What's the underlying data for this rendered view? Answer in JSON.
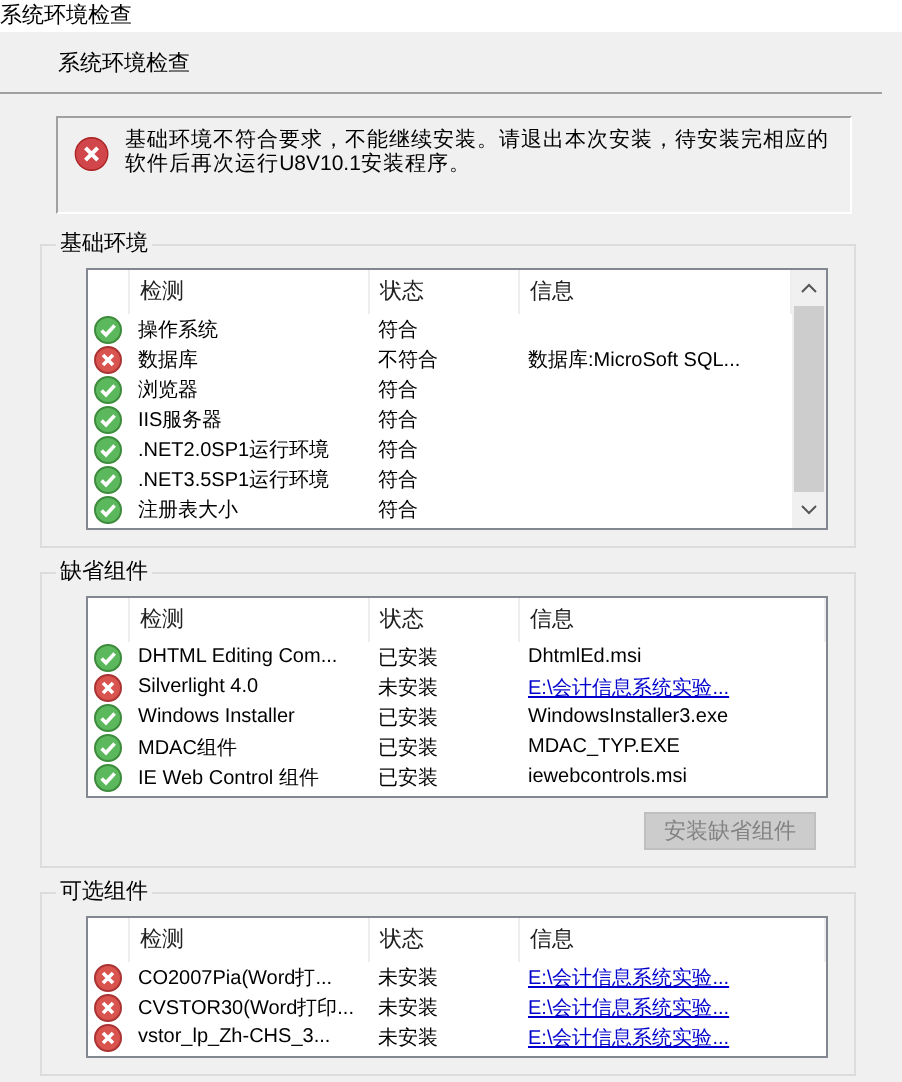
{
  "window": {
    "title": "系统环境检查"
  },
  "header": "系统环境检查",
  "error_message": "基础环境不符合要求，不能继续安装。请退出本次安装，待安装完相应的软件后再次运行U8V10.1安装程序。",
  "groups": [
    {
      "title": "基础环境",
      "scrollbar": true,
      "columns": [
        "检测",
        "状态",
        "信息"
      ],
      "rows": [
        {
          "check": "操作系统",
          "status": "符合",
          "kind": "ok"
        },
        {
          "check": "数据库",
          "status": "不符合",
          "kind": "fail",
          "info": "数据库:MicroSoft SQL...",
          "info_link": false
        },
        {
          "check": "浏览器",
          "status": "符合",
          "kind": "ok"
        },
        {
          "check": "IIS服务器",
          "status": "符合",
          "kind": "ok"
        },
        {
          "check": ".NET2.0SP1运行环境",
          "status": "符合",
          "kind": "ok"
        },
        {
          "check": ".NET3.5SP1运行环境",
          "status": "符合",
          "kind": "ok"
        },
        {
          "check": "注册表大小",
          "status": "符合",
          "kind": "ok"
        }
      ]
    },
    {
      "title": "缺省组件",
      "scrollbar": false,
      "columns": [
        "检测",
        "状态",
        "信息"
      ],
      "rows": [
        {
          "check": "DHTML Editing Com...",
          "status": "已安装",
          "kind": "ok",
          "info": "DhtmlEd.msi",
          "info_link": false
        },
        {
          "check": "Silverlight 4.0",
          "status": "未安装",
          "kind": "fail",
          "info": "E:\\会计信息系统实验...",
          "info_link": true
        },
        {
          "check": "Windows Installer",
          "status": "已安装",
          "kind": "ok",
          "info": "WindowsInstaller3.exe",
          "info_link": false
        },
        {
          "check": "MDAC组件",
          "status": "已安装",
          "kind": "ok",
          "info": "MDAC_TYP.EXE",
          "info_link": false
        },
        {
          "check": "IE Web Control 组件",
          "status": "已安装",
          "kind": "ok",
          "info": "iewebcontrols.msi",
          "info_link": false
        }
      ],
      "button": {
        "label": "安装缺省组件",
        "disabled": true
      }
    },
    {
      "title": "可选组件",
      "scrollbar": false,
      "columns": [
        "检测",
        "状态",
        "信息"
      ],
      "rows": [
        {
          "check": "CO2007Pia(Word打...",
          "status": "未安装",
          "kind": "fail",
          "info": "E:\\会计信息系统实验...",
          "info_link": true
        },
        {
          "check": "CVSTOR30(Word打印...",
          "status": "未安装",
          "kind": "fail",
          "info": "E:\\会计信息系统实验...",
          "info_link": true
        },
        {
          "check": "vstor_lp_Zh-CHS_3...",
          "status": "未安装",
          "kind": "fail",
          "info": "E:\\会计信息系统实验...",
          "info_link": true
        }
      ]
    }
  ]
}
